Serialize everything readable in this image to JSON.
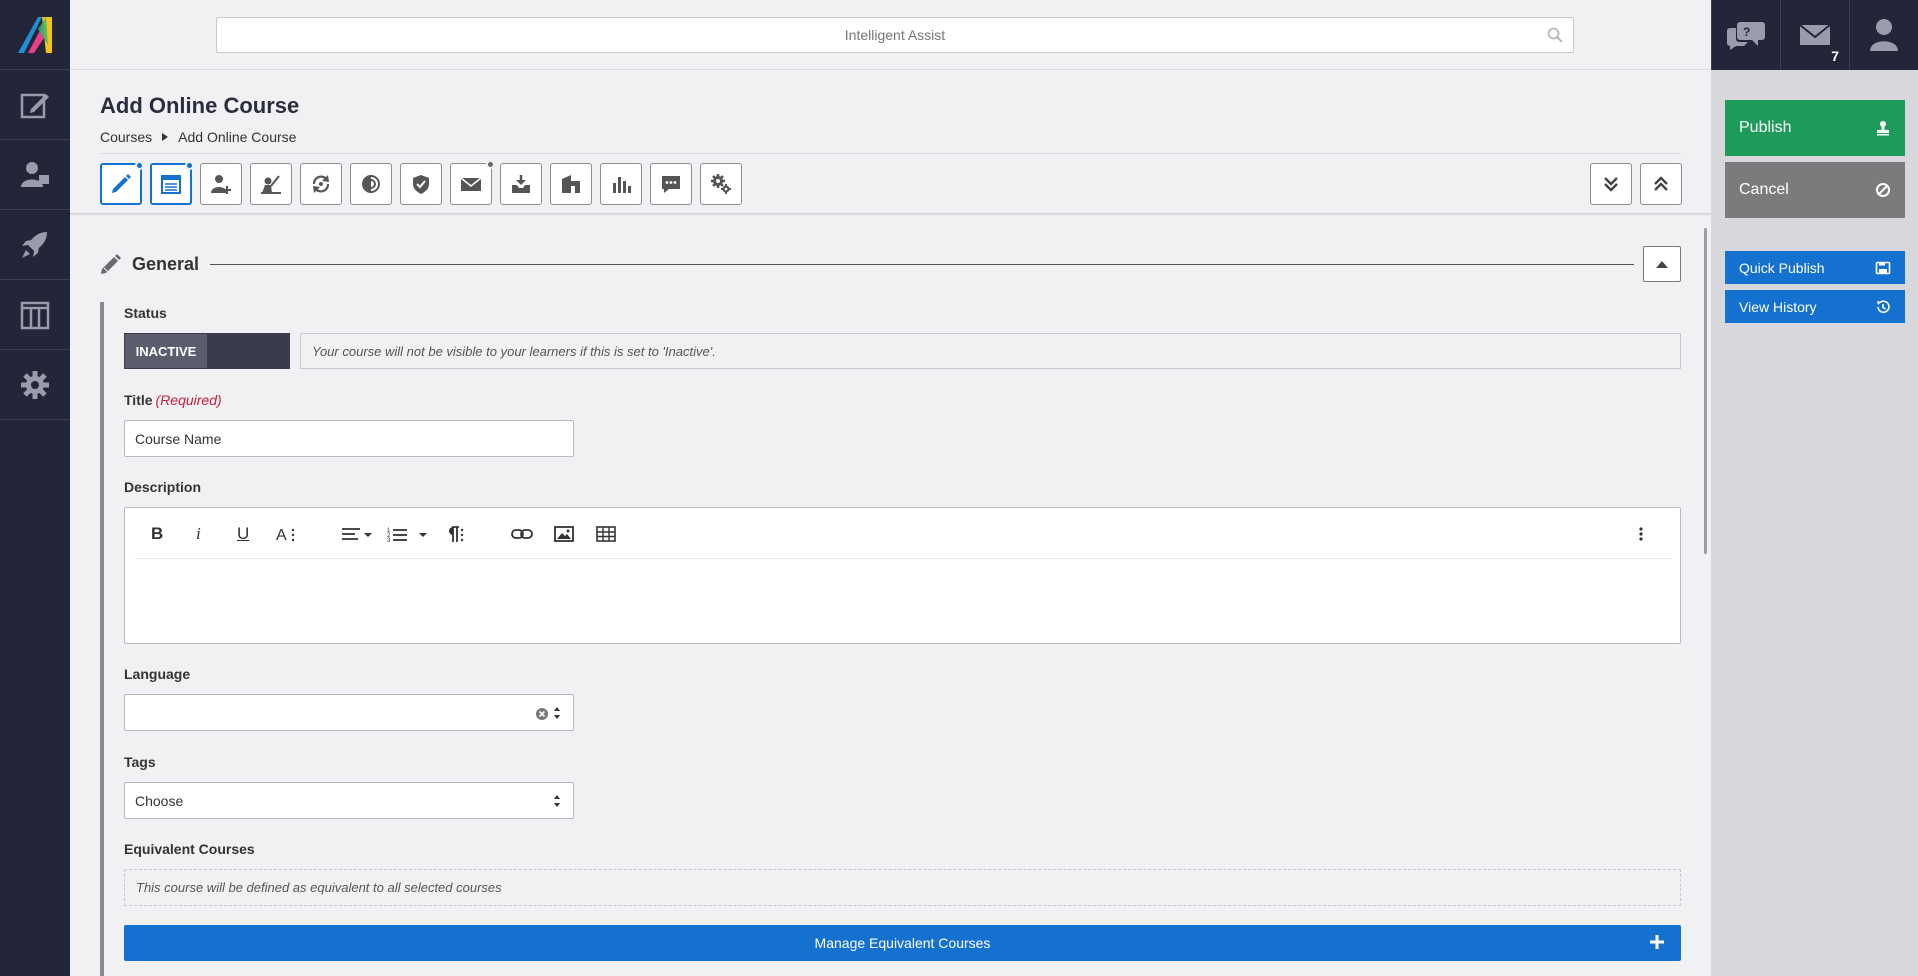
{
  "search": {
    "placeholder": "Intelligent Assist"
  },
  "nav": {
    "items": [
      "edit-icon",
      "users-icon",
      "rocket-icon",
      "columns-icon",
      "gear-icon"
    ]
  },
  "header_right": {
    "messages_count": "7"
  },
  "page": {
    "title": "Add Online Course",
    "breadcrumb": [
      "Courses",
      "Add Online Course"
    ]
  },
  "actions": {
    "publish": "Publish",
    "cancel": "Cancel",
    "quick_publish": "Quick Publish",
    "view_history": "View History"
  },
  "section": {
    "title": "General"
  },
  "form": {
    "status_label": "Status",
    "status_value": "INACTIVE",
    "status_hint": "Your course will not be visible to your learners if this is set to 'Inactive'.",
    "title_label": "Title",
    "title_required": "(Required)",
    "title_value": "Course Name",
    "description_label": "Description",
    "language_label": "Language",
    "language_value": "",
    "tags_label": "Tags",
    "tags_value": "Choose",
    "equivalent_label": "Equivalent Courses",
    "equivalent_hint": "This course will be defined as equivalent to all selected courses",
    "manage_equivalent": "Manage Equivalent Courses"
  },
  "colors": {
    "nav_bg": "#232539",
    "publish": "#1e9b5a",
    "cancel": "#7b7b7e",
    "primary": "#1471cf",
    "required": "#c0223b"
  }
}
